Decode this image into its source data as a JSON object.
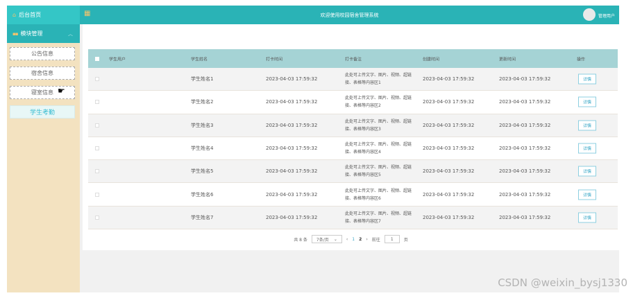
{
  "sidebar": {
    "home_label": "后台首页",
    "group_label": "模块管理",
    "items": [
      {
        "label": "公告信息"
      },
      {
        "label": "宿舍信息"
      },
      {
        "label": "寝室信息"
      },
      {
        "label": "学生考勤"
      }
    ]
  },
  "header": {
    "title": "欢迎使用校园宿舍管理系统",
    "user": "管理用户"
  },
  "table": {
    "columns": [
      "学生用户",
      "学生姓名",
      "打卡时间",
      "打卡备注",
      "创建时间",
      "更新时间",
      "操作"
    ],
    "rows": [
      {
        "name": "学生姓名1",
        "time": "2023-04-03 17:59:32",
        "note": "此处可上传文字、图片、视频、超链接、表格等内容区1",
        "created": "2023-04-03 17:59:32",
        "updated": "2023-04-03 17:59:32",
        "action": "详情"
      },
      {
        "name": "学生姓名2",
        "time": "2023-04-03 17:59:32",
        "note": "此处可上传文字、图片、视频、超链接、表格等内容区2",
        "created": "2023-04-03 17:59:32",
        "updated": "2023-04-03 17:59:32",
        "action": "详情"
      },
      {
        "name": "学生姓名3",
        "time": "2023-04-03 17:59:32",
        "note": "此处可上传文字、图片、视频、超链接、表格等内容区3",
        "created": "2023-04-03 17:59:32",
        "updated": "2023-04-03 17:59:32",
        "action": "详情"
      },
      {
        "name": "学生姓名4",
        "time": "2023-04-03 17:59:32",
        "note": "此处可上传文字、图片、视频、超链接、表格等内容区4",
        "created": "2023-04-03 17:59:32",
        "updated": "2023-04-03 17:59:32",
        "action": "详情"
      },
      {
        "name": "学生姓名5",
        "time": "2023-04-03 17:59:32",
        "note": "此处可上传文字、图片、视频、超链接、表格等内容区5",
        "created": "2023-04-03 17:59:32",
        "updated": "2023-04-03 17:59:32",
        "action": "详情"
      },
      {
        "name": "学生姓名6",
        "time": "2023-04-03 17:59:32",
        "note": "此处可上传文字、图片、视频、超链接、表格等内容区6",
        "created": "2023-04-03 17:59:32",
        "updated": "2023-04-03 17:59:32",
        "action": "详情"
      },
      {
        "name": "学生姓名7",
        "time": "2023-04-03 17:59:32",
        "note": "此处可上传文字、图片、视频、超链接、表格等内容区7",
        "created": "2023-04-03 17:59:32",
        "updated": "2023-04-03 17:59:32",
        "action": "详情"
      }
    ]
  },
  "pagination": {
    "total": "共 8 条",
    "page_size": "7条/页",
    "prev": "‹",
    "pages": [
      "1",
      "2"
    ],
    "current": "2",
    "next": "›",
    "goto_label": "前往",
    "goto_value": "1",
    "goto_suffix": "页"
  },
  "watermark": "CSDN @weixin_bysj1330"
}
